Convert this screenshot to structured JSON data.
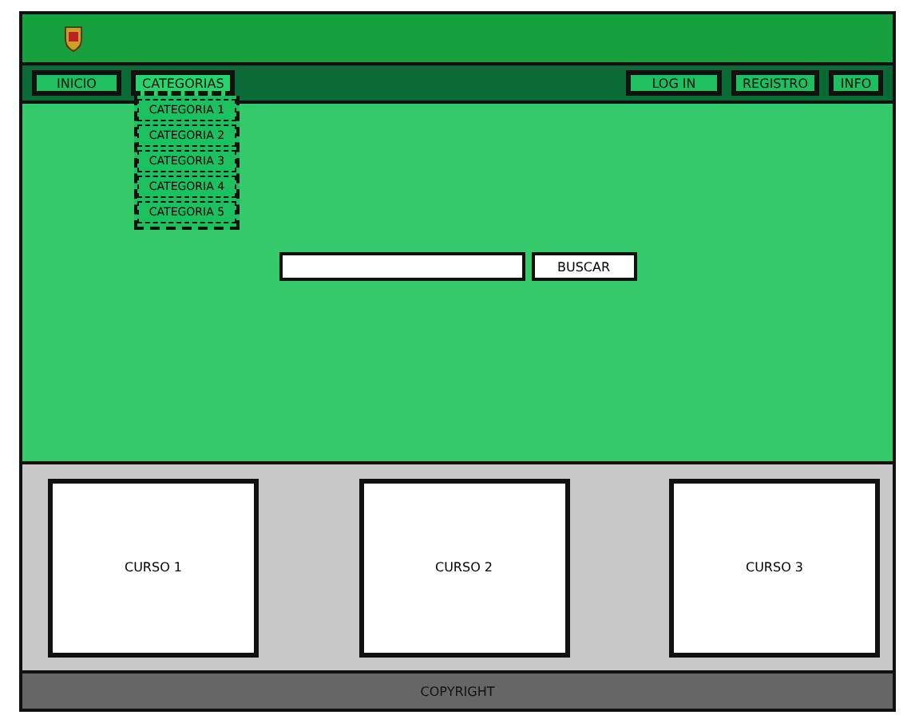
{
  "nav": {
    "left": [
      {
        "label": "INICIO"
      },
      {
        "label": "CATEGORIAS",
        "expanded": true
      }
    ],
    "right": [
      {
        "label": "LOG IN"
      },
      {
        "label": "REGISTRO"
      },
      {
        "label": "INFO"
      }
    ]
  },
  "categories": [
    "CATEGORIA 1",
    "CATEGORIA 2",
    "CATEGORIA 3",
    "CATEGORIA 4",
    "CATEGORIA 5"
  ],
  "search": {
    "button": "BUSCAR"
  },
  "courses": [
    "CURSO 1",
    "CURSO 2",
    "CURSO 3"
  ],
  "footer": "COPYRIGHT"
}
